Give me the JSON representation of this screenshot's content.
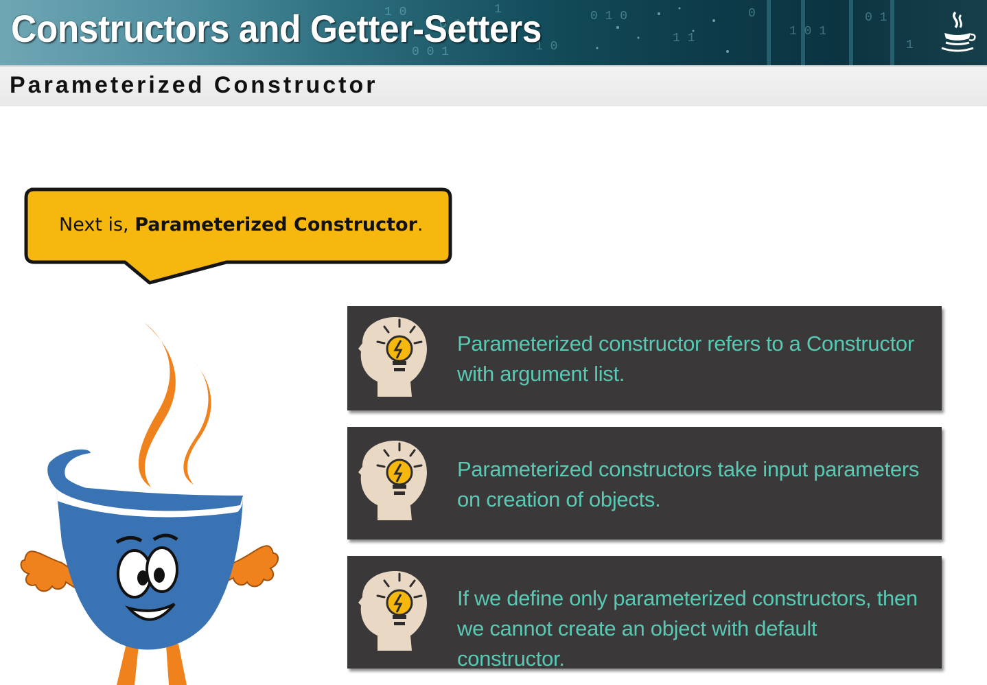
{
  "header": {
    "title": "Constructors and Getter-Setters",
    "logo_icon": "java-coffee-cup-icon"
  },
  "subheader": {
    "title": "Parameterized Constructor"
  },
  "speech_bubble": {
    "prefix": "Next is, ",
    "emphasis": "Parameterized Constructor",
    "suffix": "."
  },
  "mascot": {
    "icon": "java-cup-mascot"
  },
  "cards": [
    {
      "icon": "head-lightbulb-icon",
      "text_line1": "Parameterized constructor refers to a Constructor",
      "text_line2": "with argument list."
    },
    {
      "icon": "head-lightbulb-icon",
      "text_line1": "Parameterized constructors take input parameters",
      "text_line2": "on creation of objects."
    },
    {
      "icon": "head-lightbulb-icon",
      "text_line1": "If we define only parameterized constructors, then",
      "text_line2": "we cannot create an object with default constructor."
    }
  ],
  "colors": {
    "bubble_fill": "#f6b70f",
    "card_bg": "#3a3839",
    "card_text": "#59c9b3",
    "cup_blue": "#3a73b4",
    "steam_orange": "#f0821e"
  }
}
